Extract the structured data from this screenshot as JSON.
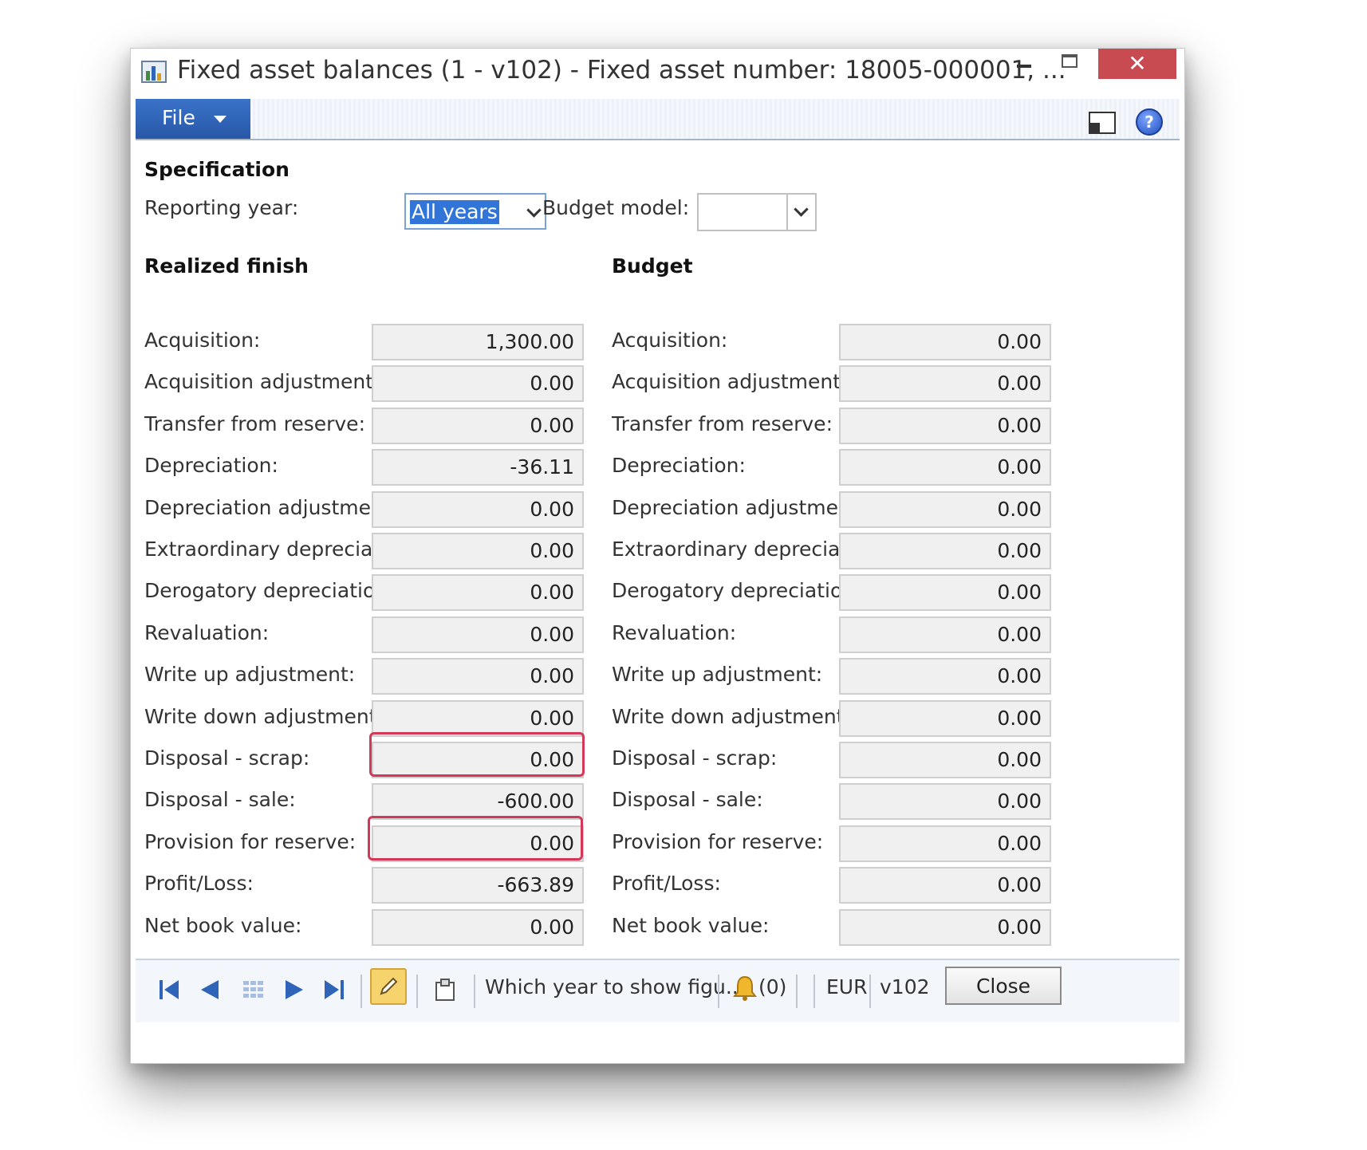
{
  "window": {
    "title": "Fixed asset balances (1 - v102) - Fixed asset number: 18005-000001, ...",
    "close_glyph": "✕"
  },
  "ribbon": {
    "file_label": "File",
    "help_glyph": "?"
  },
  "specification": {
    "heading": "Specification",
    "reporting_year_label": "Reporting year:",
    "reporting_year_value": "All years",
    "budget_model_label": "Budget model:",
    "budget_model_value": ""
  },
  "realized": {
    "heading": "Realized finish",
    "rows": [
      {
        "label": "Acquisition:",
        "value": "1,300.00"
      },
      {
        "label": "Acquisition adjustment:",
        "value": "0.00"
      },
      {
        "label": "Transfer from reserve:",
        "value": "0.00"
      },
      {
        "label": "Depreciation:",
        "value": "-36.11"
      },
      {
        "label": "Depreciation adjustment:",
        "value": "0.00"
      },
      {
        "label": "Extraordinary depreciation:",
        "value": "0.00"
      },
      {
        "label": "Derogatory depreciation:",
        "value": "0.00"
      },
      {
        "label": "Revaluation:",
        "value": "0.00"
      },
      {
        "label": "Write up adjustment:",
        "value": "0.00"
      },
      {
        "label": "Write down adjustment:",
        "value": "0.00"
      },
      {
        "label": "Disposal - scrap:",
        "value": "0.00"
      },
      {
        "label": "Disposal - sale:",
        "value": "-600.00"
      },
      {
        "label": "Provision for reserve:",
        "value": "0.00"
      },
      {
        "label": "Profit/Loss:",
        "value": "-663.89"
      },
      {
        "label": "Net book value:",
        "value": "0.00"
      }
    ]
  },
  "budget": {
    "heading": "Budget",
    "rows": [
      {
        "label": "Acquisition:",
        "value": "0.00"
      },
      {
        "label": "Acquisition adjustment:",
        "value": "0.00"
      },
      {
        "label": "Transfer from reserve:",
        "value": "0.00"
      },
      {
        "label": "Depreciation:",
        "value": "0.00"
      },
      {
        "label": "Depreciation adjustment:",
        "value": "0.00"
      },
      {
        "label": "Extraordinary depreciation:",
        "value": "0.00"
      },
      {
        "label": "Derogatory depreciation:",
        "value": "0.00"
      },
      {
        "label": "Revaluation:",
        "value": "0.00"
      },
      {
        "label": "Write up adjustment:",
        "value": "0.00"
      },
      {
        "label": "Write down adjustment:",
        "value": "0.00"
      },
      {
        "label": "Disposal - scrap:",
        "value": "0.00"
      },
      {
        "label": "Disposal - sale:",
        "value": "0.00"
      },
      {
        "label": "Provision for reserve:",
        "value": "0.00"
      },
      {
        "label": "Profit/Loss:",
        "value": "0.00"
      },
      {
        "label": "Net book value:",
        "value": "0.00"
      }
    ]
  },
  "statusbar": {
    "help_text": "Which year to show figu...",
    "notifications": "(0)",
    "currency": "EUR",
    "partition": "v102",
    "close_label": "Close"
  },
  "colors": {
    "accent": "#2f64b9",
    "highlight": "#d43858",
    "close_button": "#c74b50"
  }
}
